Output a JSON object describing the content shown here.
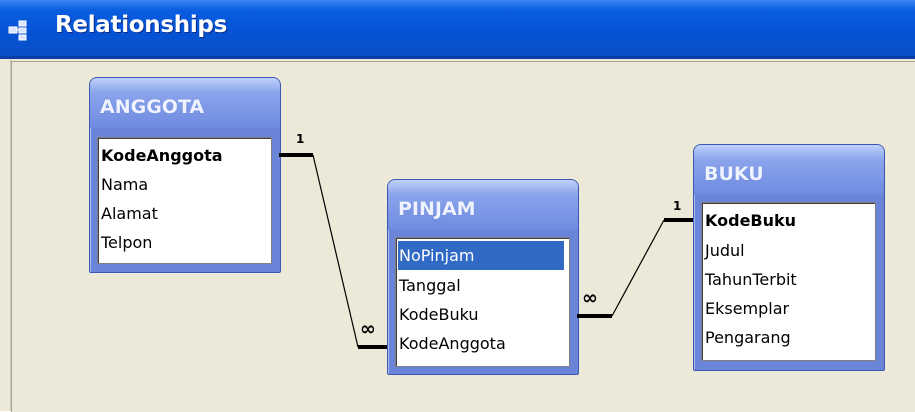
{
  "window": {
    "title": "Relationships",
    "icon": "relationships-icon"
  },
  "tables": {
    "anggota": {
      "name": "ANGGOTA",
      "fields": [
        "KodeAnggota",
        "Nama",
        "Alamat",
        "Telpon"
      ],
      "primary_key": "KodeAnggota"
    },
    "pinjam": {
      "name": "PINJAM",
      "fields": [
        "NoPinjam",
        "Tanggal",
        "KodeBuku",
        "KodeAnggota"
      ],
      "selected_field": "NoPinjam"
    },
    "buku": {
      "name": "BUKU",
      "fields": [
        "KodeBuku",
        "Judul",
        "TahunTerbit",
        "Eksemplar",
        "Pengarang"
      ],
      "primary_key": "KodeBuku"
    }
  },
  "relationships": [
    {
      "from": "ANGGOTA.KodeAnggota",
      "to": "PINJAM.KodeAnggota",
      "one_label": "1",
      "many_label": "∞"
    },
    {
      "from": "BUKU.KodeBuku",
      "to": "PINJAM.KodeBuku",
      "one_label": "1",
      "many_label": "∞"
    }
  ],
  "colors": {
    "titlebar": "#0653d6",
    "table_header": "#6f8be0",
    "selection": "#316ac5",
    "workspace": "#ece9d8"
  }
}
